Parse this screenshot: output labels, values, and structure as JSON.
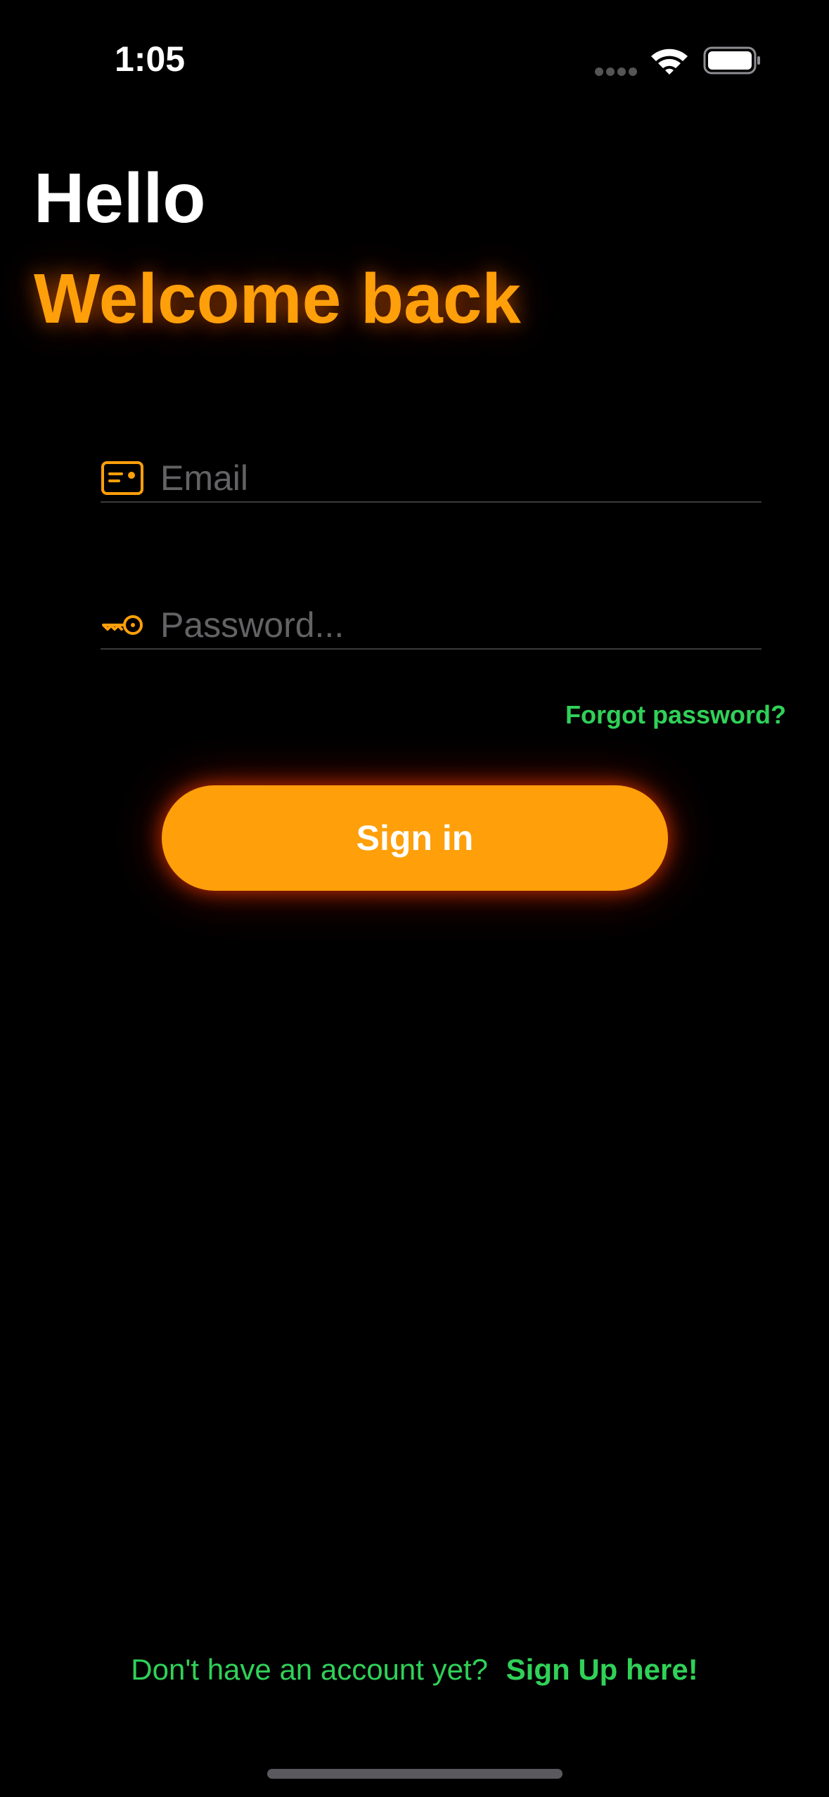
{
  "status_bar": {
    "time": "1:05",
    "icons": [
      "signal-dots-icon",
      "wifi-icon",
      "battery-icon"
    ]
  },
  "header": {
    "greeting": "Hello",
    "subtitle": "Welcome back"
  },
  "form": {
    "email": {
      "icon": "id-card-icon",
      "placeholder": "Email",
      "value": ""
    },
    "password": {
      "icon": "key-icon",
      "placeholder": "Password...",
      "value": ""
    },
    "forgot_label": "Forgot password?",
    "signin_label": "Sign in"
  },
  "footer": {
    "prompt": "Don't have an account yet?",
    "signup_label": "Sign Up here!"
  },
  "colors": {
    "background": "#000000",
    "accent": "#ff9f0a",
    "link": "#30d158",
    "placeholder": "#636366",
    "divider": "#3a3a3c"
  }
}
